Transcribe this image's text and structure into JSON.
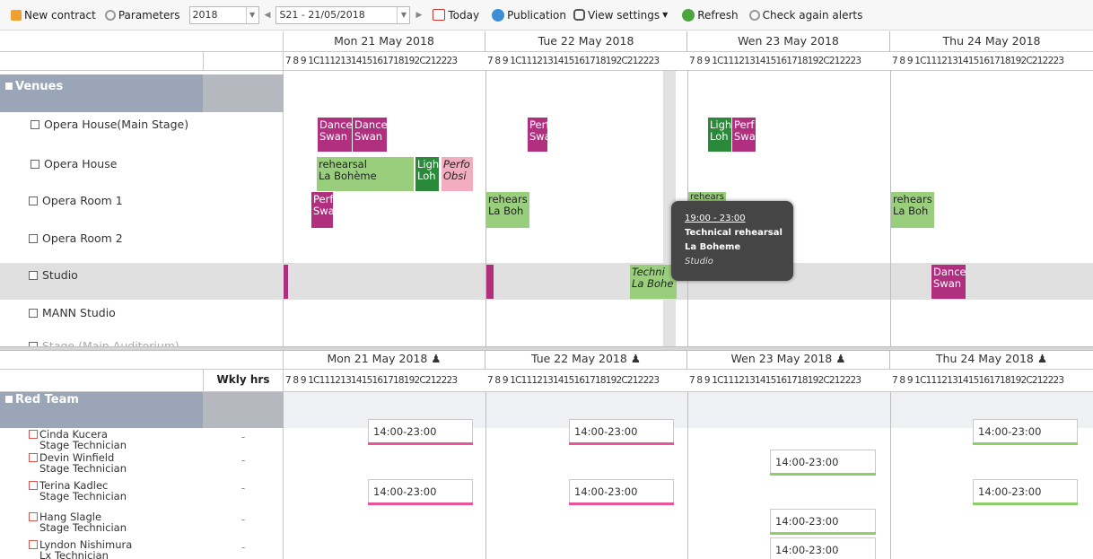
{
  "toolbar": {
    "new_contract": "New contract",
    "parameters": "Parameters",
    "year": "2018",
    "week": "S21 - 21/05/2018",
    "today": "Today",
    "publication": "Publication",
    "view_settings": "View settings",
    "refresh": "Refresh",
    "check_alerts": "Check again alerts"
  },
  "days": [
    "Mon 21 May 2018",
    "Tue 22 May 2018",
    "Wen 23 May 2018",
    "Thu 24 May 2018"
  ],
  "hours": "7 8 9 1C1112131415161718192C212223",
  "top_group": "Venues",
  "venues": [
    "Opera House(Main Stage)",
    "Opera House",
    "Opera Room 1",
    "Opera Room 2",
    "Studio",
    "MANN Studio",
    "Stage (Main Auditorium)"
  ],
  "events": [
    {
      "l1": "Dance",
      "l2": "Swan"
    },
    {
      "l1": "Dance",
      "l2": "Swan"
    },
    {
      "l1": "Perf",
      "l2": "Swa"
    },
    {
      "l1": "Ligh",
      "l2": "Loh"
    },
    {
      "l1": "Perf",
      "l2": "Swa"
    },
    {
      "l1": "rehearsal",
      "l2": "La Bohème"
    },
    {
      "l1": "Ligh",
      "l2": "Loh"
    },
    {
      "l1": "Perfo",
      "l2": "Obsi"
    },
    {
      "l1": "Perf",
      "l2": "Swa"
    },
    {
      "l1": "rehears",
      "l2": "La Boh"
    },
    {
      "l1": "rehears",
      "l2": ""
    },
    {
      "l1": "rehears",
      "l2": "La Boh"
    },
    {
      "l1": "Techni",
      "l2": "La Bohe"
    },
    {
      "l1": "Dance",
      "l2": "Swan"
    }
  ],
  "tooltip": {
    "time": "19:00 - 23:00",
    "title": "Technical rehearsal",
    "show": "La Boheme",
    "room": "Studio"
  },
  "bottom": {
    "weekly_hours": "Wkly hrs",
    "group": "Red Team",
    "people": [
      {
        "name": "Cinda Kucera",
        "role": "Stage Technician",
        "hrs": "-"
      },
      {
        "name": "Devin Winfield",
        "role": "Stage Technician",
        "hrs": "-"
      },
      {
        "name": "Terina Kadlec",
        "role": "Stage Technician",
        "hrs": "-"
      },
      {
        "name": "Hang Slagle",
        "role": "Stage Technician",
        "hrs": "-"
      },
      {
        "name": "Lyndon Nishimura",
        "role": "Lx Technician",
        "hrs": "-"
      }
    ],
    "shift_label": "14:00-23:00"
  },
  "colors": {
    "purple": "#b0307f",
    "green": "#2a8a3a",
    "light_green": "#99cf7c",
    "pink": "#f2aec0",
    "shift_pink": "#e8559b",
    "shift_green": "#8ccf6a",
    "group_header": "#9aa6b8"
  }
}
